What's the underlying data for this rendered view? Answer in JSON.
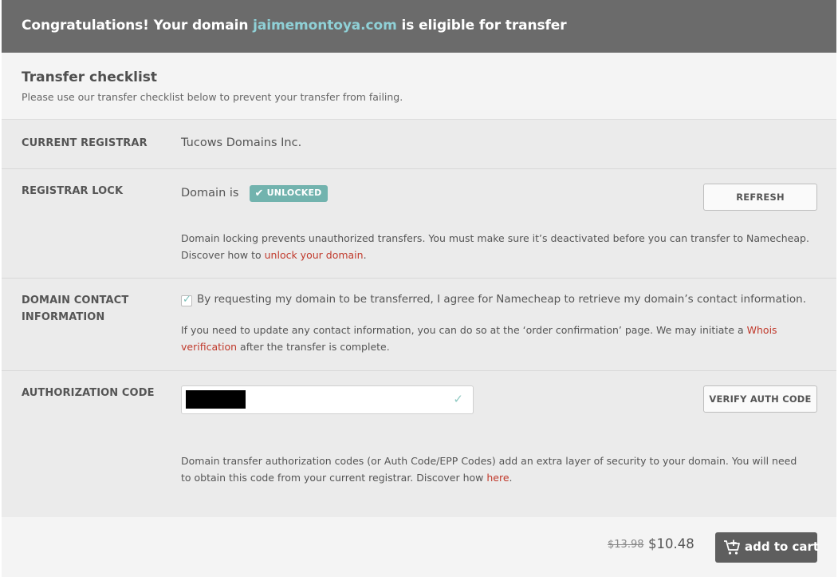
{
  "header": {
    "prefix": "Congratulations! Your domain ",
    "domain": "jaimemontoya.com",
    "suffix": " is eligible for transfer"
  },
  "checklist": {
    "title": "Transfer checklist",
    "subtitle": "Please use our transfer checklist below to prevent your transfer from failing."
  },
  "registrar": {
    "label": "CURRENT REGISTRAR",
    "value": "Tucows Domains Inc."
  },
  "lock": {
    "label": "REGISTRAR LOCK",
    "prefix": "Domain is",
    "status": "UNLOCKED",
    "refresh_label": "REFRESH",
    "info_line1": "Domain locking prevents unauthorized transfers. You must make sure it’s deactivated before you can transfer to Namecheap.",
    "info_line2_prefix": "Discover how to ",
    "info_link": "unlock your domain",
    "info_line2_suffix": "."
  },
  "contact": {
    "label_line1": "DOMAIN CONTACT",
    "label_line2": "INFORMATION",
    "agree_text": "By requesting my domain to be transferred, I agree for Namecheap to retrieve my domain’s contact information.",
    "agree_checked": true,
    "info_prefix": "If you need to update any contact information, you can do so at the ‘order confirmation’ page. We may initiate a ",
    "info_link_1": "Whois",
    "info_link_2": "verification",
    "info_suffix": " after the transfer is complete."
  },
  "auth": {
    "label": "AUTHORIZATION CODE",
    "verify_label": "VERIFY AUTH CODE",
    "info_line1": "Domain transfer authorization codes (or Auth Code/EPP Codes) add an extra layer of security to your domain. You will need",
    "info_line2_prefix": "to obtain this code from your current registrar. Discover how ",
    "info_link": "here",
    "info_line2_suffix": "."
  },
  "footer": {
    "old_price": "$13.98",
    "new_price": "$10.48",
    "cart_label": "add to cart"
  },
  "colors": {
    "header_bg": "#6b6b6b",
    "domain_accent": "#8fd0d6",
    "badge_teal": "#72b3ae",
    "link_red": "#c0392b",
    "cart_button": "#5e5e5e"
  },
  "icons": {
    "badge_check": "check-icon",
    "input_valid": "check-icon",
    "cart": "cart-plus-icon"
  }
}
